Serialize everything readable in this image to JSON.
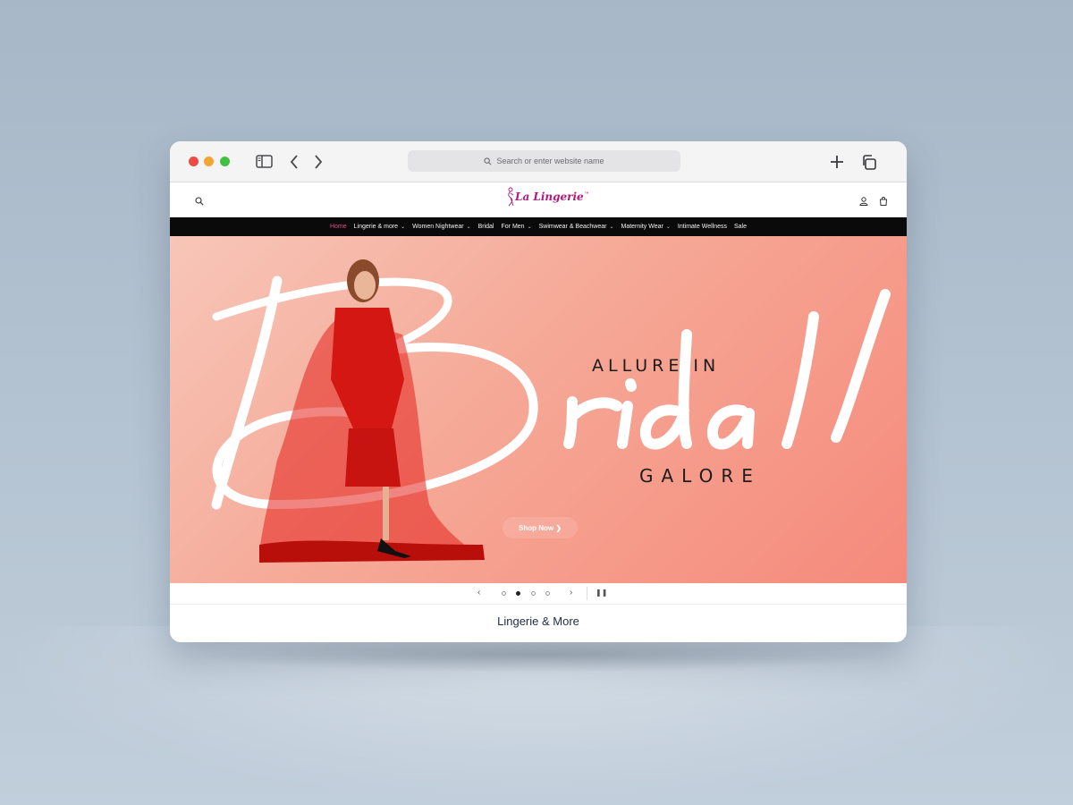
{
  "browser": {
    "address_placeholder": "Search or enter website name",
    "icons": [
      "sidebar-icon",
      "back-icon",
      "forward-icon",
      "new-tab-icon",
      "tabs-overview-icon"
    ]
  },
  "site": {
    "logo_text": "La Lingerie",
    "logo_mark": "™",
    "brand_color": "#b5177a"
  },
  "nav": {
    "items": [
      {
        "label": "Home",
        "active": true
      },
      {
        "label": "Lingerie & more",
        "dropdown": true
      },
      {
        "label": "Women Nightwear",
        "dropdown": true
      },
      {
        "label": "Bridal"
      },
      {
        "label": "For Men",
        "dropdown": true
      },
      {
        "label": "Swimwear & Beachwear",
        "dropdown": true
      },
      {
        "label": "Maternity Wear",
        "dropdown": true
      },
      {
        "label": "Intimate Wellness"
      },
      {
        "label": "Sale"
      }
    ],
    "active_color": "#e84a8a"
  },
  "hero": {
    "line1": "ALLURE IN",
    "script_word": "Bridal",
    "line3": "GALORE",
    "cta_label": "Shop Now ❯"
  },
  "slider": {
    "slide_count": 4,
    "active_index": 1
  },
  "section": {
    "title": "Lingerie & More"
  }
}
